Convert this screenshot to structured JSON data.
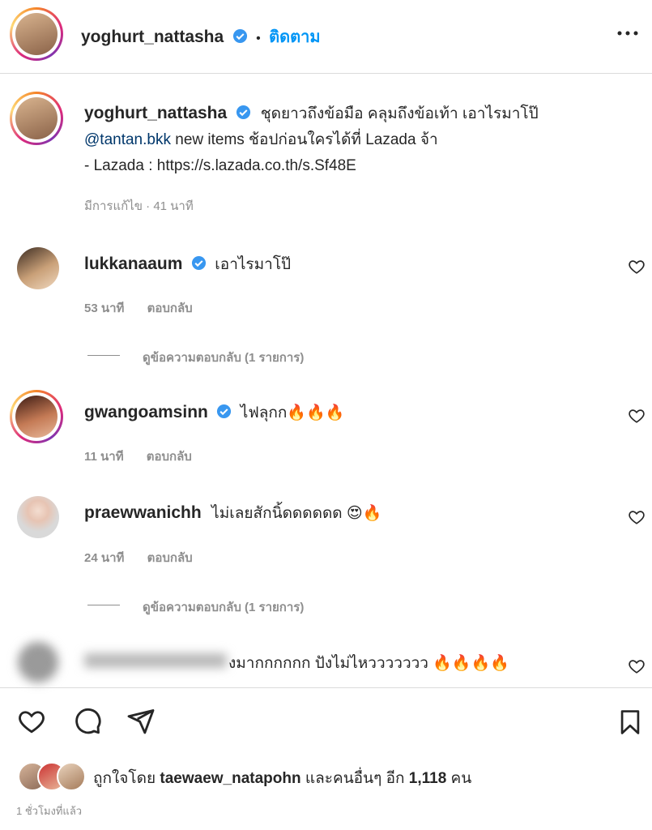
{
  "header": {
    "username": "yoghurt_nattasha",
    "dot": "•",
    "follow_label": "ติดตาม",
    "more_icon": "more-horizontal-icon"
  },
  "caption": {
    "username": "yoghurt_nattasha",
    "line1": "ชุดยาวถึงข้อมือ คลุมถึงข้อเท้า เอาไรมาโป๊",
    "mention": "@tantan.bkk",
    "line2_rest": " new items ช้อปก่อนใครได้ที่ Lazada จ้า",
    "line3": "- Lazada : https://s.lazada.co.th/s.Sf48E",
    "meta": "มีการแก้ไข · 41 นาที"
  },
  "comments": [
    {
      "username": "lukkanaaum",
      "verified": true,
      "text": "เอาไรมาโป๊",
      "time": "53 นาที",
      "reply": "ตอบกลับ",
      "view_replies": "ดูข้อความตอบกลับ (1 รายการ)"
    },
    {
      "username": "gwangoamsinn",
      "verified": true,
      "text": "ไฟลุกก🔥🔥🔥",
      "time": "11 นาที",
      "reply": "ตอบกลับ"
    },
    {
      "username": "praewwanichh",
      "verified": false,
      "text": "ไม่เลยสักนิ้ดดดดดด 😍🔥",
      "time": "24 นาที",
      "reply": "ตอบกลับ",
      "view_replies": "ดูข้อความตอบกลับ (1 รายการ)"
    },
    {
      "username": "",
      "verified": false,
      "text": "งมากกกกกก ปังไม่ไหววววววว 🔥🔥🔥🔥",
      "time": "",
      "reply": ""
    }
  ],
  "actions": {
    "like_icon": "heart-icon",
    "comment_icon": "comment-icon",
    "share_icon": "send-icon",
    "save_icon": "bookmark-icon"
  },
  "likes": {
    "prefix": "ถูกใจโดย",
    "user": "taewaew_natapohn",
    "suffix": "และคนอื่นๆ อีก",
    "count": "1,118",
    "unit": "คน"
  },
  "timestamp": "1 ชั่วโมงที่แล้ว",
  "colors": {
    "accent": "#0095f6",
    "verified": "#3897f0",
    "text": "#262626",
    "muted": "#8e8e8e",
    "divider": "#dbdbdb"
  }
}
